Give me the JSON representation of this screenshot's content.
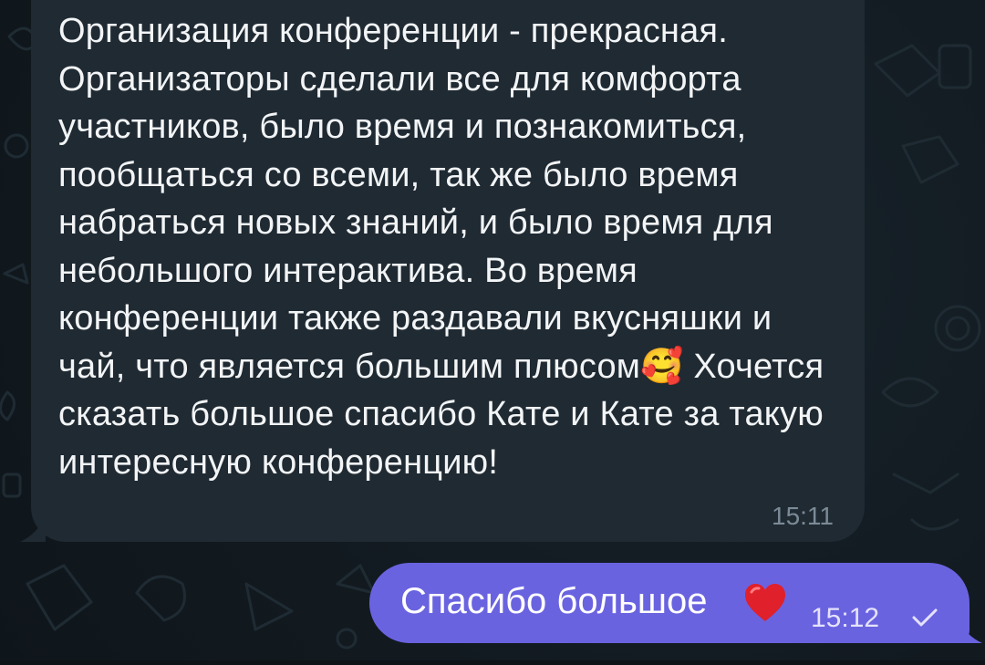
{
  "chat": {
    "incoming": {
      "text_before_emoji": "Организация конференции - прекрасная. Организаторы сделали все для комфорта участников, было время и познакомиться, пообщаться со всеми, так же было время набраться новых знаний, и было время для небольшого интерактива. Во время конференции также раздавали вкусняшки и чай, что является большим плюсом",
      "emoji": "🥰",
      "text_after_emoji": " Хочется сказать большое спасибо Кате и Кате за такую интересную конференцию!",
      "time": "15:11"
    },
    "outgoing": {
      "text": "Спасибо большое",
      "emoji": "heart-icon",
      "time": "15:12",
      "status_icon": "check-icon"
    }
  },
  "colors": {
    "background": "#121a20",
    "incoming_bubble": "#1f2a33",
    "outgoing_bubble": "#6a63e0",
    "text": "#f2f4f5",
    "time_in": "#7b8a96"
  }
}
